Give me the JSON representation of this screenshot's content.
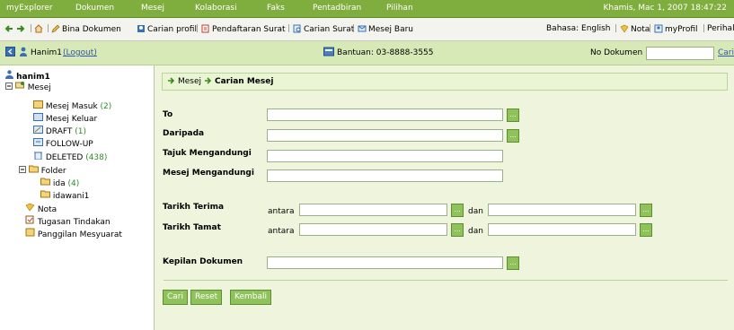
{
  "menubar": {
    "items": [
      "myExplorer",
      "Dokumen",
      "Mesej",
      "Kolaborasi",
      "Faks",
      "Pentadbiran",
      "Pilihan"
    ],
    "clock": "Khamis, Mac 1, 2007 18:47:22"
  },
  "toolbar": {
    "bina_dokumen": "Bina Dokumen",
    "carian_profil": "Carian profil",
    "pendaftaran_surat": "Pendaftaran Surat",
    "carian_surat": "Carian Surat",
    "mesej_baru": "Mesej Baru",
    "bahasa": "Bahasa: English",
    "nota": "Nota",
    "myprofil": "myProfil",
    "perihal": "Perihal",
    "sep": "|"
  },
  "userbar": {
    "username": "Hanim1",
    "logout": "(Logout)",
    "bantuan": "Bantuan: 03-8888-3555",
    "no_dokumen_label": "No Dokumen",
    "no_dokumen_value": "",
    "cari": "Cari"
  },
  "sidebar": {
    "user": "hanim1",
    "mesej": "Mesej",
    "mesej_masuk": "Mesej Masuk",
    "mesej_masuk_count": "(2)",
    "mesej_keluar": "Mesej Keluar",
    "draft": "DRAFT",
    "draft_count": "(1)",
    "follow_up": "FOLLOW-UP",
    "deleted": "DELETED",
    "deleted_count": "(438)",
    "folder": "Folder",
    "ida": "ida",
    "ida_count": "(4)",
    "idawani1": "idawani1",
    "nota": "Nota",
    "tugasan": "Tugasan Tindakan",
    "panggilan": "Panggilan Mesyuarat"
  },
  "breadcrumb": {
    "part1": "Mesej",
    "part2": "Carian Mesej"
  },
  "form": {
    "to": "To",
    "daripada": "Daripada",
    "tajuk": "Tajuk Mengandungi",
    "mesej": "Mesej Mengandungi",
    "tarikh_terima": "Tarikh Terima",
    "tarikh_tamat": "Tarikh Tamat",
    "antara": "antara",
    "dan": "dan",
    "kepilan": "Kepilan Dokumen",
    "picker": "..."
  },
  "buttons": {
    "cari": "Cari",
    "reset": "Reset",
    "kembali": "Kembali"
  },
  "colors": {
    "menubar": "#7fae3f",
    "userbar": "#d6e9b6",
    "main_bg": "#eef5dc",
    "button": "#8fc25b"
  }
}
